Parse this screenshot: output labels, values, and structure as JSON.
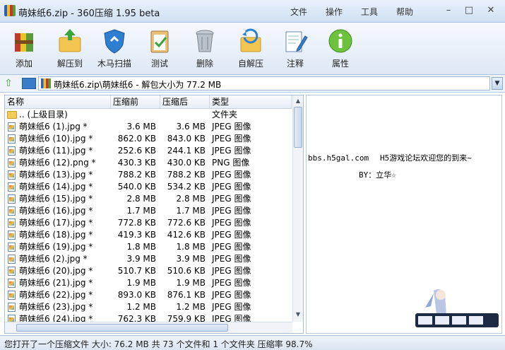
{
  "window": {
    "title": "萌妹纸6.zip - 360压缩 1.95 beta",
    "menu": [
      "文件",
      "操作",
      "工具",
      "帮助"
    ]
  },
  "toolbar": {
    "buttons": [
      {
        "label": "添加",
        "icon": "add-archive-icon"
      },
      {
        "label": "解压到",
        "icon": "extract-to-icon"
      },
      {
        "label": "木马扫描",
        "icon": "trojan-scan-shield-icon"
      },
      {
        "label": "测试",
        "icon": "test-clipboard-icon"
      },
      {
        "label": "删除",
        "icon": "delete-bin-icon"
      },
      {
        "label": "自解压",
        "icon": "self-extract-icon"
      },
      {
        "label": "注释",
        "icon": "comment-pencil-icon"
      },
      {
        "label": "属性",
        "icon": "info-icon"
      }
    ]
  },
  "pathbar": {
    "path": "萌妹纸6.zip\\萌妹纸6 - 解包大小为 77.2 MB"
  },
  "filelist": {
    "headers": {
      "name": "名称",
      "before": "压缩前",
      "after": "压缩后",
      "type": "类型"
    },
    "parent": {
      "name": ".. (上级目录)",
      "type": "文件夹"
    },
    "rows": [
      {
        "name": "萌妹纸6 (1).jpg *",
        "before": "3.6 MB",
        "after": "3.6 MB",
        "type": "JPEG 图像"
      },
      {
        "name": "萌妹纸6 (10).jpg *",
        "before": "862.0 KB",
        "after": "843.0 KB",
        "type": "JPEG 图像"
      },
      {
        "name": "萌妹纸6 (11).jpg *",
        "before": "252.6 KB",
        "after": "244.1 KB",
        "type": "JPEG 图像"
      },
      {
        "name": "萌妹纸6 (12).png *",
        "before": "430.3 KB",
        "after": "430.0 KB",
        "type": "PNG 图像"
      },
      {
        "name": "萌妹纸6 (13).jpg *",
        "before": "788.2 KB",
        "after": "788.2 KB",
        "type": "JPEG 图像"
      },
      {
        "name": "萌妹纸6 (14).jpg *",
        "before": "540.0 KB",
        "after": "534.2 KB",
        "type": "JPEG 图像"
      },
      {
        "name": "萌妹纸6 (15).jpg *",
        "before": "2.8 MB",
        "after": "2.8 MB",
        "type": "JPEG 图像"
      },
      {
        "name": "萌妹纸6 (16).jpg *",
        "before": "1.7 MB",
        "after": "1.7 MB",
        "type": "JPEG 图像"
      },
      {
        "name": "萌妹纸6 (17).jpg *",
        "before": "772.8 KB",
        "after": "772.6 KB",
        "type": "JPEG 图像"
      },
      {
        "name": "萌妹纸6 (18).jpg *",
        "before": "419.3 KB",
        "after": "412.6 KB",
        "type": "JPEG 图像"
      },
      {
        "name": "萌妹纸6 (19).jpg *",
        "before": "1.8 MB",
        "after": "1.8 MB",
        "type": "JPEG 图像"
      },
      {
        "name": "萌妹纸6 (2).jpg *",
        "before": "3.9 MB",
        "after": "3.9 MB",
        "type": "JPEG 图像"
      },
      {
        "name": "萌妹纸6 (20).jpg *",
        "before": "510.7 KB",
        "after": "510.6 KB",
        "type": "JPEG 图像"
      },
      {
        "name": "萌妹纸6 (21).jpg *",
        "before": "1.9 MB",
        "after": "1.9 MB",
        "type": "JPEG 图像"
      },
      {
        "name": "萌妹纸6 (22).jpg *",
        "before": "893.0 KB",
        "after": "876.1 KB",
        "type": "JPEG 图像"
      },
      {
        "name": "萌妹纸6 (23).jpg *",
        "before": "1.2 MB",
        "after": "1.2 MB",
        "type": "JPEG 图像"
      },
      {
        "name": "萌妹纸6 (24).jpg *",
        "before": "762.3 KB",
        "after": "759.9 KB",
        "type": "JPEG 图像"
      }
    ]
  },
  "preview": {
    "line1_a": "bbs.h5gal.com",
    "line1_b": "H5游戏论坛欢迎您的到来~",
    "line2": "BY：立华☆"
  },
  "status": {
    "text": "您打开了一个压缩文件 大小: 76.2 MB 共 73 个文件和 1 个文件夹 压缩率 98.7%"
  },
  "colors": {
    "accent": "#3b7cc9",
    "title_bar": "#d8e6f6",
    "toolbar": "#e6eef8"
  }
}
